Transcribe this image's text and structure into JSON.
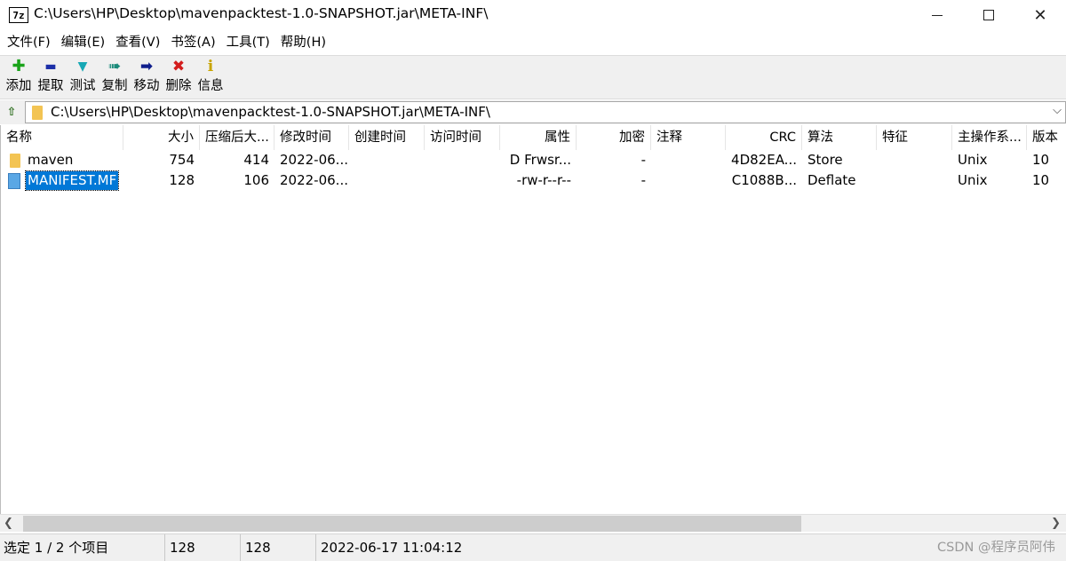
{
  "window": {
    "app_icon": "7z",
    "title": "C:\\Users\\HP\\Desktop\\mavenpacktest-1.0-SNAPSHOT.jar\\META-INF\\"
  },
  "menu": [
    "文件(F)",
    "编辑(E)",
    "查看(V)",
    "书签(A)",
    "工具(T)",
    "帮助(H)"
  ],
  "toolbar": [
    {
      "label": "添加",
      "icon": "add-icon",
      "glyph": "✚",
      "color": "#1aa31a"
    },
    {
      "label": "提取",
      "icon": "extract-icon",
      "glyph": "▬",
      "color": "#1c2fa8"
    },
    {
      "label": "测试",
      "icon": "test-icon",
      "glyph": "▼",
      "color": "#17a8b5"
    },
    {
      "label": "复制",
      "icon": "copy-icon",
      "glyph": "➠",
      "color": "#1a8a7a"
    },
    {
      "label": "移动",
      "icon": "move-icon",
      "glyph": "➡",
      "color": "#0f1e8c"
    },
    {
      "label": "删除",
      "icon": "delete-icon",
      "glyph": "✖",
      "color": "#d31d1d"
    },
    {
      "label": "信息",
      "icon": "info-icon",
      "glyph": "i",
      "color": "#c8a400"
    }
  ],
  "address": {
    "path": "C:\\Users\\HP\\Desktop\\mavenpacktest-1.0-SNAPSHOT.jar\\META-INF\\"
  },
  "columns": [
    "名称",
    "大小",
    "压缩后大...",
    "修改时间",
    "创建时间",
    "访问时间",
    "属性",
    "加密",
    "注释",
    "CRC",
    "算法",
    "特征",
    "主操作系...",
    "版本"
  ],
  "rows": [
    {
      "name": "maven",
      "type": "folder",
      "size": "754",
      "packed": "414",
      "modified": "2022-06...",
      "created": "",
      "accessed": "",
      "attr": "D Frwsr...",
      "encrypted": "-",
      "comment": "",
      "crc": "4D82EA...",
      "method": "Store",
      "characteristics": "",
      "host_os": "Unix",
      "version": "10",
      "selected": false
    },
    {
      "name": "MANIFEST.MF",
      "type": "file",
      "size": "128",
      "packed": "106",
      "modified": "2022-06...",
      "created": "",
      "accessed": "",
      "attr": "-rw-r--r--",
      "encrypted": "-",
      "comment": "",
      "crc": "C1088B...",
      "method": "Deflate",
      "characteristics": "",
      "host_os": "Unix",
      "version": "10",
      "selected": true
    }
  ],
  "status": {
    "selection": "选定 1 / 2 个项目",
    "size": "128",
    "packed": "128",
    "modified": "2022-06-17 11:04:12",
    "watermark": "CSDN @程序员阿伟"
  },
  "colors": {
    "selection": "#0078d7",
    "folder": "#f3c453",
    "file": "#5aa7e5"
  }
}
